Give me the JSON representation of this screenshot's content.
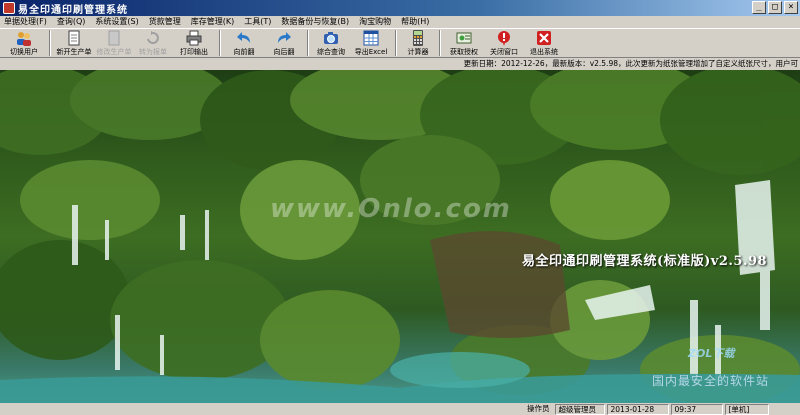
{
  "window": {
    "title": "易全印通印刷管理系统"
  },
  "menu": [
    {
      "label": "单据处理(F)"
    },
    {
      "label": "查询(Q)"
    },
    {
      "label": "系统设置(S)"
    },
    {
      "label": "货款管理"
    },
    {
      "label": "库存管理(K)"
    },
    {
      "label": "工具(T)"
    },
    {
      "label": "数据备份与恢复(B)"
    },
    {
      "label": "淘宝购物"
    },
    {
      "label": "帮助(H)"
    }
  ],
  "toolbar": {
    "switch_user": "切换用户",
    "new_order": "新开生产单",
    "edit_order": "修改生产单",
    "to_quote": "转为报单",
    "print_out": "打印输出",
    "prev_page": "向前翻",
    "next_page": "向后翻",
    "query": "综合查询",
    "export_excel": "导出Excel",
    "calculator": "计算器",
    "get_license": "获取授权",
    "close_window": "关闭窗口",
    "exit_system": "退出系统"
  },
  "notice": "更新日期：2012-12-26，最新版本：v2.5.98，此次更新为纸张管理增加了自定义纸张尺寸，用户可",
  "banner": "易全印通印刷管理系统(标准版)v2.5.98",
  "watermark": {
    "site": "www.Onlo.com",
    "brand": "ZOL下载",
    "sub": "国内最安全的软件站"
  },
  "status": {
    "operator_label": "操作员",
    "operator": "超级管理员",
    "date": "2013-01-28",
    "time": "09:37",
    "mode": "[单机]"
  }
}
